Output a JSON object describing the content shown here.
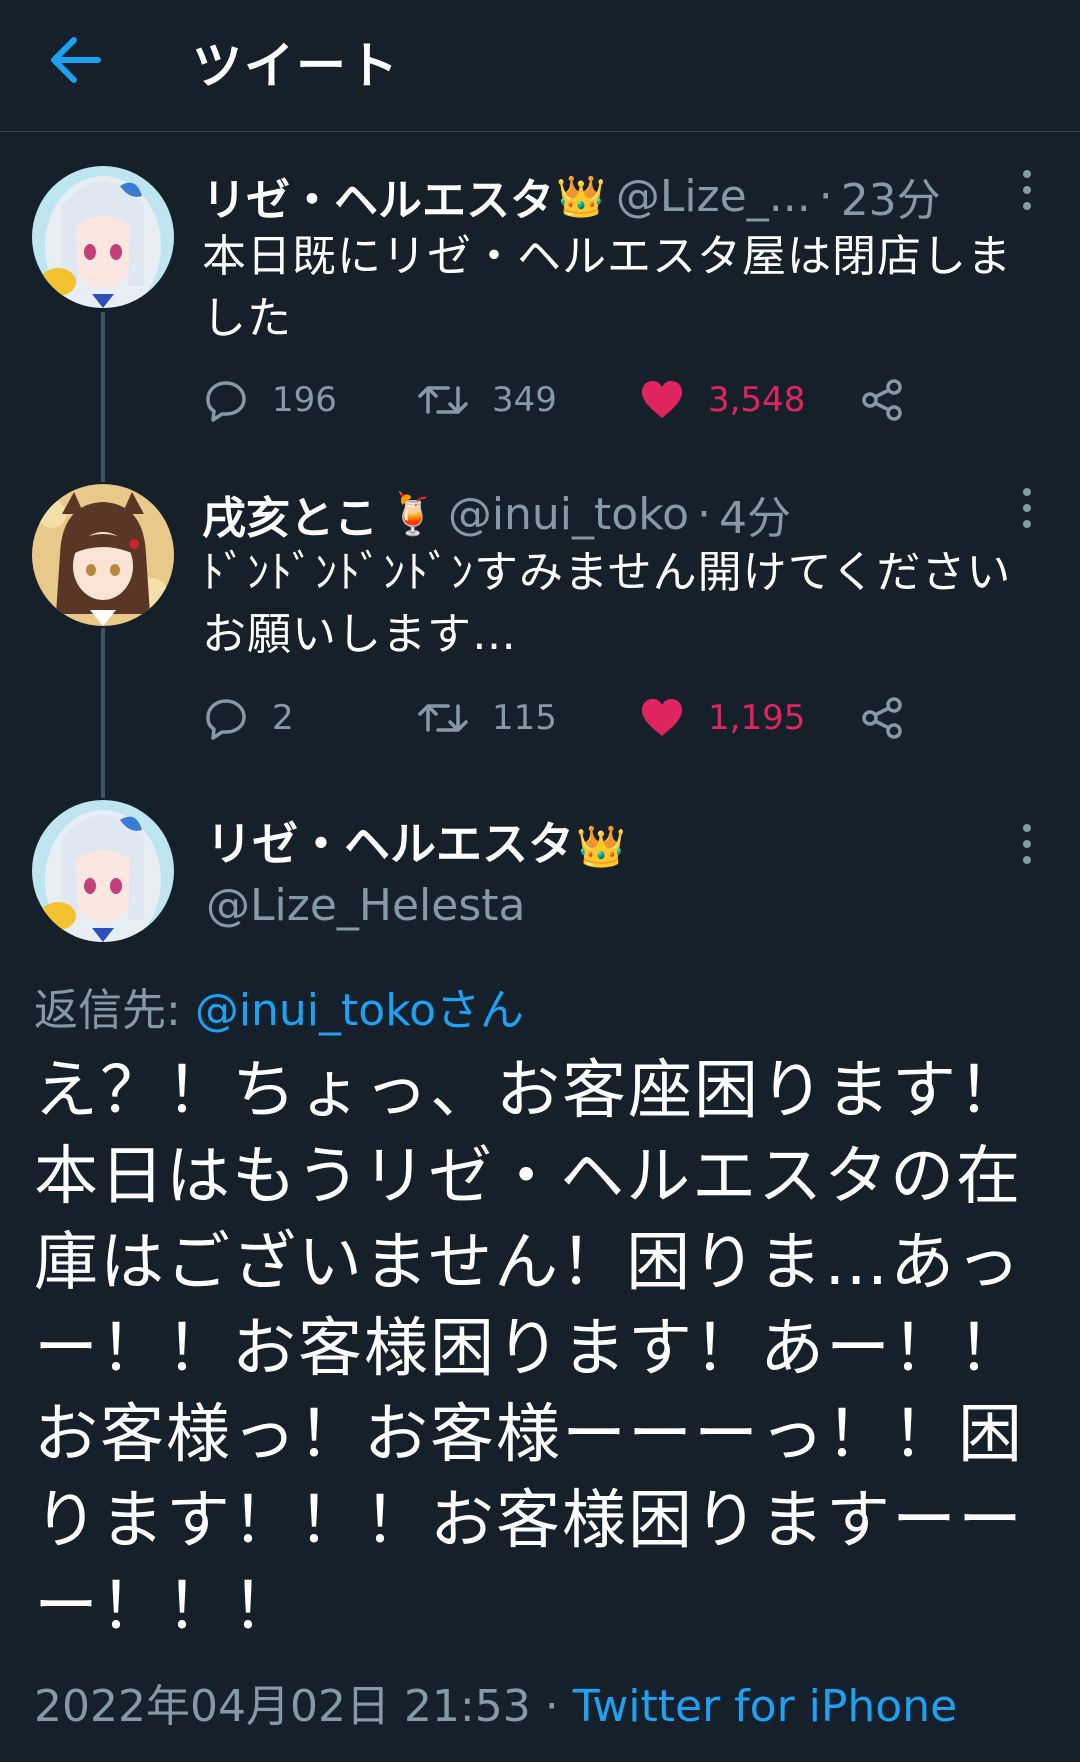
{
  "header": {
    "title": "ツイート"
  },
  "tweets": [
    {
      "name": "リゼ・ヘルエスタ",
      "badge": "👑",
      "handle": "@Lize_...",
      "separator": "·",
      "time": "23分",
      "text": "本日既にリゼ・ヘルエスタ屋は閉店しました",
      "replies": "196",
      "retweets": "349",
      "likes": "3,548"
    },
    {
      "name": "戌亥とこ",
      "badge": "🍹",
      "handle": "@inui_toko",
      "separator": "·",
      "time": "4分",
      "text": "ﾄﾞﾝﾄﾞﾝﾄﾞﾝﾄﾞﾝすみません開けてくださいお願いします…",
      "replies": "2",
      "retweets": "115",
      "likes": "1,195"
    }
  ],
  "main_tweet": {
    "name": "リゼ・ヘルエスタ",
    "badge": "👑",
    "handle": "@Lize_Helesta",
    "reply_label": "返信先: ",
    "reply_mention": "@inui_tokoさん",
    "text": "え？！ちょっ、お客座困ります！本日はもうリゼ・ヘルエスタの在庫はございません！困りま…あっー！！お客様困ります！あー！！お客様っ！お客様ーーーっ！！困ります！！！お客様困りますーーー！！！",
    "timestamp": "2022年04月02日 21:53",
    "meta_separator": " · ",
    "source": "Twitter for iPhone"
  },
  "colors": {
    "background": "#15202b",
    "secondary_text": "#8899a6",
    "link": "#1da1f2",
    "like": "#e0245e"
  },
  "icons": {
    "back": "arrow-left-icon",
    "reply": "reply-icon",
    "retweet": "retweet-icon",
    "like": "heart-icon",
    "share": "share-icon",
    "more": "more-vertical-icon"
  }
}
